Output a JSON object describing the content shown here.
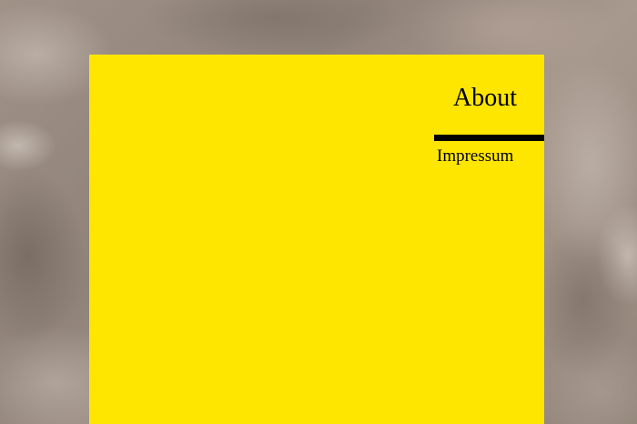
{
  "nav": {
    "items": [
      {
        "label": "About",
        "active": true
      },
      {
        "label": "Impressum",
        "active": false
      }
    ]
  },
  "colors": {
    "panel": "#ffe600",
    "text": "#000000",
    "active_indicator": "#000000",
    "background": "stone-texture"
  }
}
